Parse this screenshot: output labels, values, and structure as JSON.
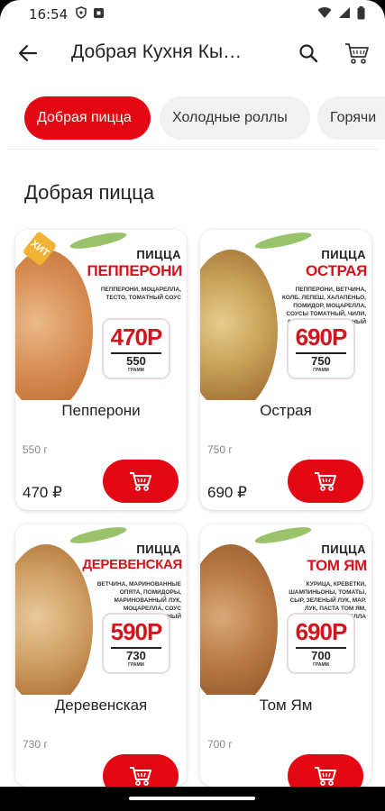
{
  "status_bar": {
    "time": "16:54",
    "icons": [
      "shield-icon",
      "notification-icon",
      "wifi-icon",
      "signal-icon",
      "battery-icon"
    ]
  },
  "app_bar": {
    "title": "Добрая Кухня Кы…",
    "icons": [
      "back-arrow-icon",
      "search-icon",
      "cart-icon"
    ]
  },
  "categories": [
    {
      "label": "Добрая пицца",
      "active": true
    },
    {
      "label": "Холодные роллы",
      "active": false
    },
    {
      "label": "Горячи",
      "active": false
    }
  ],
  "section": {
    "title": "Добрая пицца"
  },
  "products": [
    {
      "name": "Пепперони",
      "weight": "550 г",
      "price": "470 ₽",
      "promo": {
        "label": "ПИЦЦА",
        "name": "ПЕППЕРОНИ",
        "desc": "ПЕППЕРОНИ, МОЦАРЕЛЛА, ТЕСТО, ТОМАТНЫЙ СОУС",
        "price": "470Р",
        "weight": "550",
        "unit": "ГРАММ",
        "tag": "ХИТ"
      }
    },
    {
      "name": "Острая",
      "weight": "750 г",
      "price": "690 ₽",
      "promo": {
        "label": "ПИЦЦА",
        "name": "ОСТРАЯ",
        "desc": "ПЕППЕРОНИ, ВЕТЧИНА, КОЛБ. ЛЕПЕШ, ХАЛАПЕНЬО, ПОМИДОР, МОЦАРЕЛЛА, СОУСЫ ТОМАТНЫЙ, ЧИЛИ, СЛАДКИЙ ЧИЛИ, СЫРНЫЙ",
        "price": "690Р",
        "weight": "750",
        "unit": "ГРАММ"
      }
    },
    {
      "name": "Деревенская",
      "weight": "730 г",
      "price": "",
      "promo": {
        "label": "ПИЦЦА",
        "name": "ДЕРЕВЕНСКАЯ",
        "desc": "ВЕТЧИНА, МАРИНОВАННЫЕ ОПЯТА, ПОМИДОРЫ, МАРИНОВАННЫЙ ЛУК, МОЦАРЕЛЛА, СОУС ЗАДОРОЖНЫЙ",
        "price": "590Р",
        "weight": "730",
        "unit": "ГРАММ"
      }
    },
    {
      "name": "Том Ям",
      "weight": "700 г",
      "price": "",
      "promo": {
        "label": "ПИЦЦА",
        "name": "ТОМ ЯМ",
        "desc": "КУРИЦА, КРЕВЕТКИ, ШАМПИНЬОНЫ, ТОМАТЫ, СЫР, ЗЕЛЕНЫЙ ЛУК, МАР. ЛУК, ПАСТА ТОМ ЯМ, МОЦАРЕЛЛА",
        "price": "690Р",
        "weight": "700",
        "unit": "ГРАММ"
      }
    }
  ],
  "colors": {
    "accent": "#e30613",
    "chip_idle": "#f1f1f1"
  }
}
